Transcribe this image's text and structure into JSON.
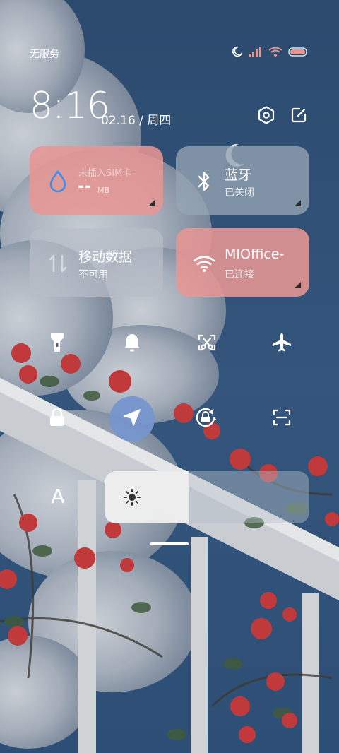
{
  "status_bar": {
    "carrier": "无服务",
    "icons": [
      "moon-icon",
      "signal-icon",
      "wifi-icon",
      "battery-icon"
    ]
  },
  "header": {
    "time": "8:16",
    "date": "02.16 / 周四",
    "settings_icon": "hexagon-settings-icon",
    "edit_icon": "edit-icon"
  },
  "tiles": {
    "data_usage": {
      "title": "未插入SIM卡",
      "value": "--",
      "unit": "MB",
      "icon": "water-drop-icon",
      "color": "#e6968f"
    },
    "bluetooth": {
      "title": "蓝牙",
      "status": "已关闭",
      "icon": "bluetooth-icon"
    },
    "mobile_data": {
      "title": "移动数据",
      "status": "不可用",
      "icon": "mobile-data-icon"
    },
    "wifi": {
      "title": "MIOffice-",
      "status": "已连接",
      "icon": "wifi-icon",
      "color": "#e6968f"
    }
  },
  "toggles_row1": [
    "flashlight-icon",
    "bell-icon",
    "screenshot-icon",
    "airplane-icon"
  ],
  "toggles_row2": [
    "lock-icon",
    "location-icon",
    "rotation-lock-icon",
    "scanner-icon"
  ],
  "brightness": {
    "auto_label": "A",
    "level": 0.41,
    "icon": "sun-icon"
  },
  "colors": {
    "active_toggle": "#7696cd",
    "sky": "#2f4f73"
  }
}
